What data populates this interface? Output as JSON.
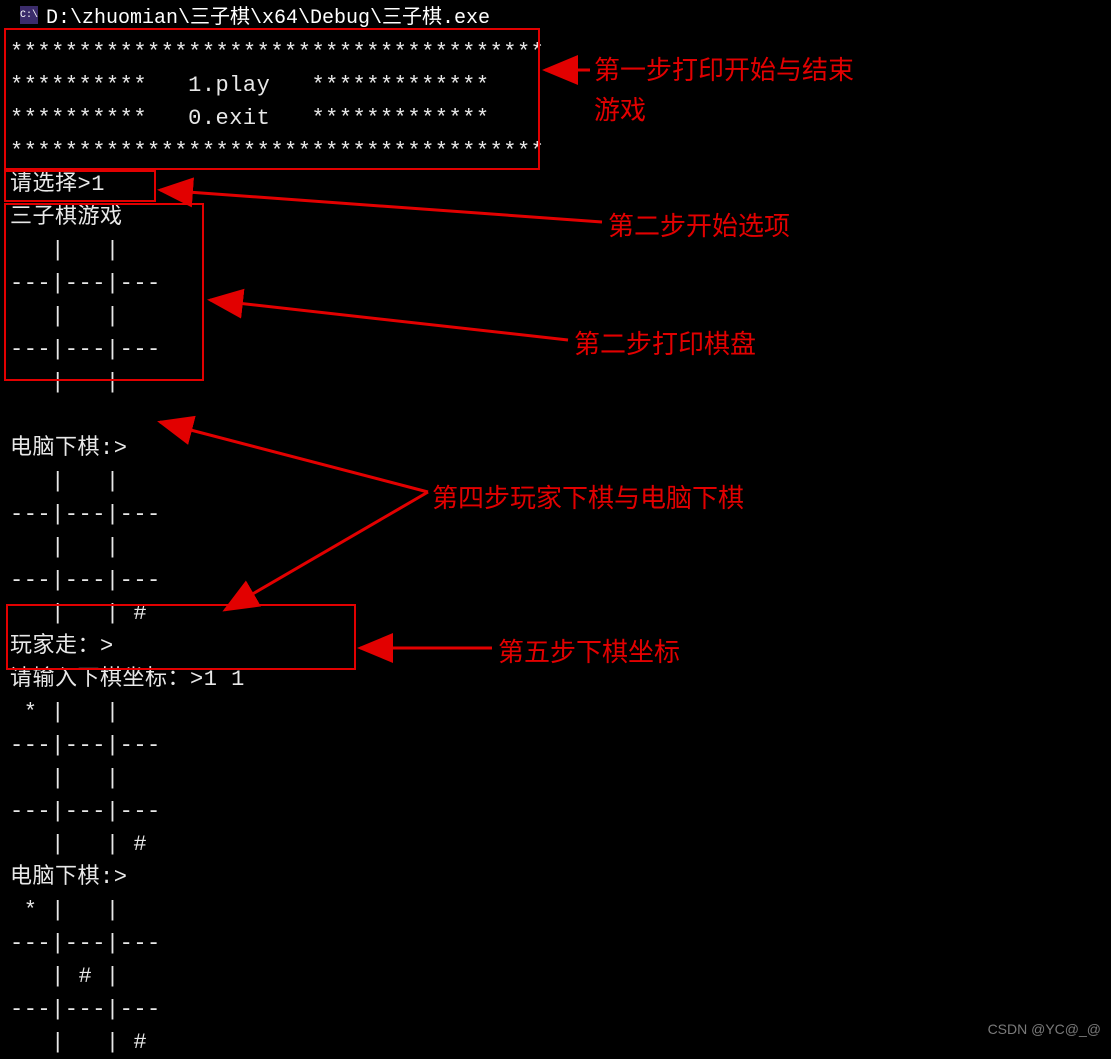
{
  "titlebar": {
    "icon_text": "C:\\",
    "path": "D:\\zhuomian\\三子棋\\x64\\Debug\\三子棋.exe"
  },
  "console": {
    "text": "***************************************\n**********   1.play   *************\n**********   0.exit   *************\n***************************************\n请选择>1\n三子棋游戏\n   |   |\n---|---|---\n   |   |\n---|---|---\n   |   |\n\n电脑下棋:>\n   |   |\n---|---|---\n   |   |\n---|---|---\n   |   | #\n玩家走：>\n请输入下棋坐标：>1 1\n * |   |\n---|---|---\n   |   |\n---|---|---\n   |   | #\n电脑下棋:>\n * |   |\n---|---|---\n   | # |\n---|---|---\n   |   | #"
  },
  "annotations": {
    "step1_line1": "第一步打印开始与结束",
    "step1_line2": "游戏",
    "step2a": "第二步开始选项",
    "step2b": "第二步打印棋盘",
    "step4": "第四步玩家下棋与电脑下棋",
    "step5": "第五步下棋坐标"
  },
  "watermark": "CSDN @YC@_@"
}
